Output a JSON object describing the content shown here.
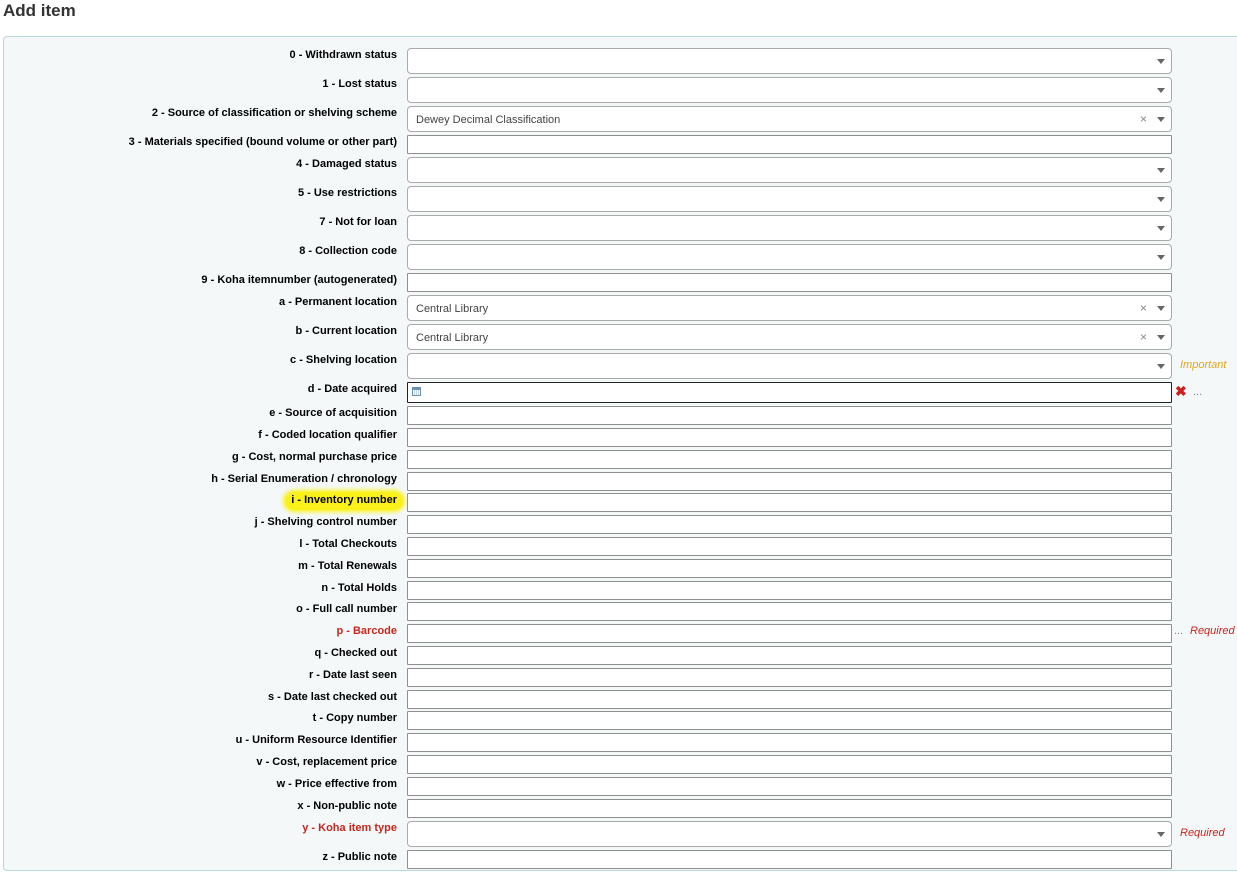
{
  "page": {
    "title": "Add item"
  },
  "fields": {
    "f0": {
      "label": "0 - Withdrawn status"
    },
    "f1": {
      "label": "1 - Lost status"
    },
    "f2": {
      "label": "2 - Source of classification or shelving scheme",
      "value": "Dewey Decimal Classification",
      "clear": "×"
    },
    "f3": {
      "label": "3 - Materials specified (bound volume or other part)"
    },
    "f4": {
      "label": "4 - Damaged status"
    },
    "f5": {
      "label": "5 - Use restrictions"
    },
    "f7": {
      "label": "7 - Not for loan"
    },
    "f8": {
      "label": "8 - Collection code"
    },
    "f9": {
      "label": "9 - Koha itemnumber (autogenerated)"
    },
    "fa": {
      "label": "a - Permanent location",
      "value": "Central Library",
      "clear": "×"
    },
    "fb": {
      "label": "b - Current location",
      "value": "Central Library",
      "clear": "×"
    },
    "fc": {
      "label": "c - Shelving location",
      "note": "Important"
    },
    "fd": {
      "label": "d - Date acquired",
      "dots": "..."
    },
    "fe": {
      "label": "e - Source of acquisition"
    },
    "ff": {
      "label": "f - Coded location qualifier"
    },
    "fg": {
      "label": "g - Cost, normal purchase price"
    },
    "fh": {
      "label": "h - Serial Enumeration / chronology"
    },
    "fi": {
      "label": "i - Inventory number"
    },
    "fj": {
      "label": "j - Shelving control number"
    },
    "fl": {
      "label": "l - Total Checkouts"
    },
    "fm": {
      "label": "m - Total Renewals"
    },
    "fn": {
      "label": "n - Total Holds"
    },
    "fo": {
      "label": "o - Full call number"
    },
    "fp": {
      "label": "p - Barcode",
      "dots": "...",
      "note": "Required"
    },
    "fq": {
      "label": "q - Checked out"
    },
    "fr": {
      "label": "r - Date last seen"
    },
    "fs": {
      "label": "s - Date last checked out"
    },
    "ft": {
      "label": "t - Copy number"
    },
    "fu": {
      "label": "u - Uniform Resource Identifier"
    },
    "fv": {
      "label": "v - Cost, replacement price"
    },
    "fw": {
      "label": "w - Price effective from"
    },
    "fx": {
      "label": "x - Non-public note"
    },
    "fy": {
      "label": "y - Koha item type",
      "note": "Required"
    },
    "fz": {
      "label": "z - Public note"
    }
  },
  "colors": {
    "panel_bg": "#f4f8f9",
    "panel_border": "#b9d8d9",
    "required": "#c9261d",
    "important": "#e1a51c",
    "highlight": "#fbf11a"
  }
}
